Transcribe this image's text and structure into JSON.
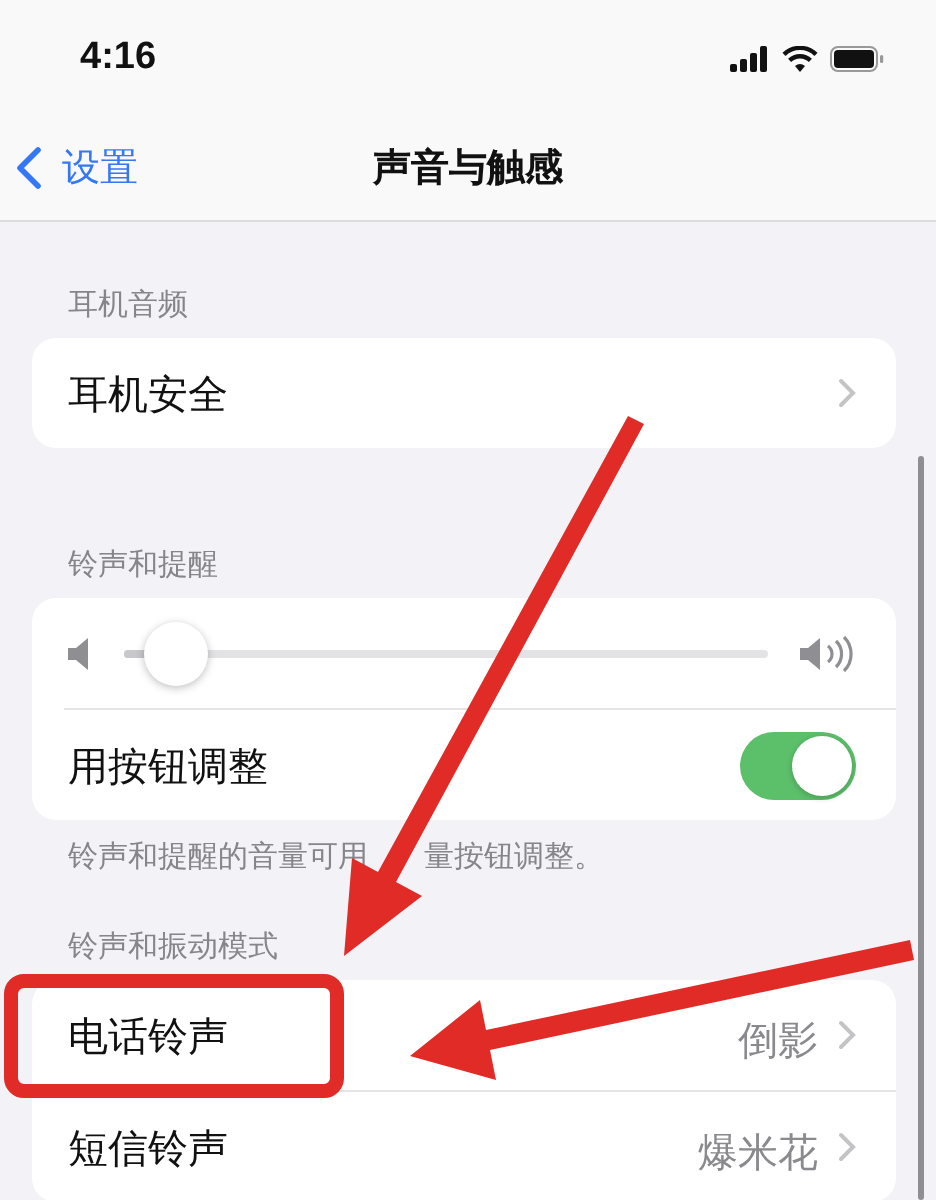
{
  "status_bar": {
    "time": "4:16"
  },
  "nav": {
    "back": "设置",
    "title": "声音与触感"
  },
  "sections": [
    {
      "header": "耳机音频",
      "rows": [
        {
          "kind": "link",
          "label": "耳机安全"
        }
      ]
    },
    {
      "header": "铃声和提醒",
      "rows": [
        {
          "kind": "slider",
          "level": 0.08
        },
        {
          "kind": "toggle",
          "label": "用按钮调整",
          "on": true
        }
      ],
      "footer": [
        "铃声和提醒的音量可用",
        "量按钮调整。"
      ]
    },
    {
      "header": "铃声和振动模式",
      "rows": [
        {
          "kind": "link",
          "label": "电话铃声",
          "value": "倒影",
          "highlighted": true
        },
        {
          "kind": "link",
          "label": "短信铃声",
          "value": "爆米花"
        }
      ]
    }
  ]
}
